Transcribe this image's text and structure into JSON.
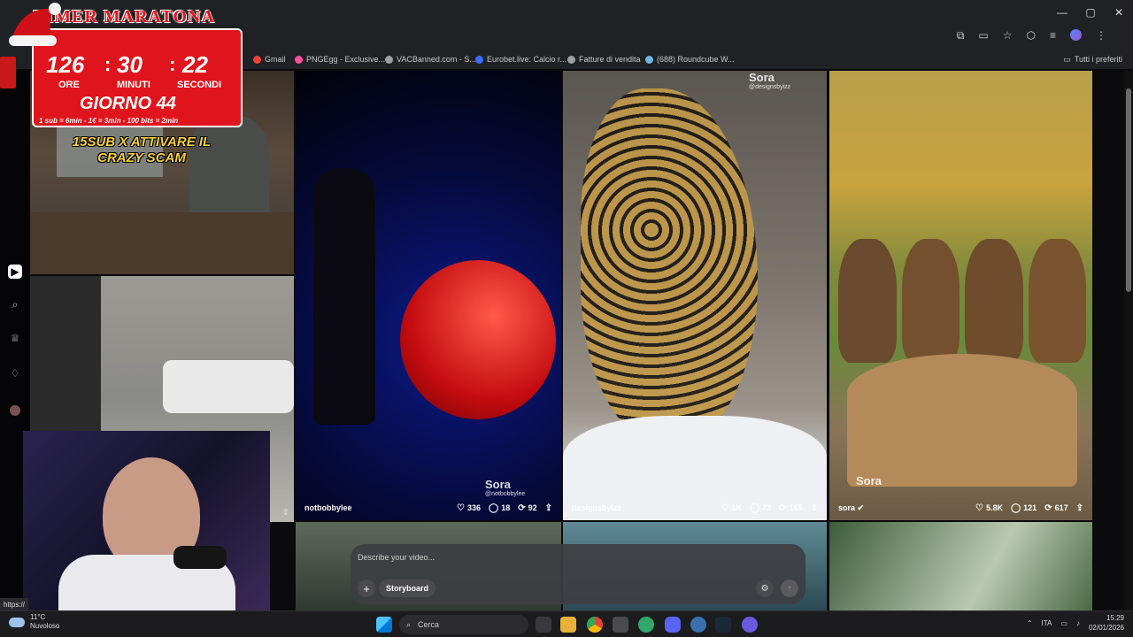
{
  "browser": {
    "window_controls": [
      "—",
      "▢",
      "✕"
    ],
    "bookmarks": [
      {
        "label": "Gmail",
        "icon": "gmail-icon",
        "color": "#ea4335"
      },
      {
        "label": "PNGEgg - Exclusive...",
        "icon": "pngegg-icon",
        "color": "#ff4fa0"
      },
      {
        "label": "VACBanned.com - S...",
        "icon": "vacbanned-icon",
        "color": "#9aa0a6"
      },
      {
        "label": "Eurobet.live: Calcio r...",
        "icon": "eurobet-icon",
        "color": "#3b6cff"
      },
      {
        "label": "Fatture di vendita",
        "icon": "fatture-icon",
        "color": "#9aa0a6"
      },
      {
        "label": "(688) Roundcube W...",
        "icon": "roundcube-icon",
        "color": "#6fb7e0"
      }
    ],
    "bookmarks_right": "Tutti i preferiti",
    "status_url": "https://"
  },
  "timer": {
    "title": "TIMER MARATONA",
    "hours": "126",
    "minutes": "30",
    "seconds": "22",
    "hours_label": "ORE",
    "minutes_label": "MINUTI",
    "seconds_label": "SECONDI",
    "day": "GIORNO 44",
    "rates": "1 sub = 6min - 1€ = 3min - 100 bits = 2min"
  },
  "promo": "15SUB X ATTIVARE IL CRAZY SCAM",
  "tiles": [
    {
      "user": "notbobbylee",
      "likes": "336",
      "comments": "18",
      "remixes": "92",
      "watermark": "Sora",
      "watermark_handle": "@notbobbylee"
    },
    {
      "user": "designsbyizz",
      "likes": "1K",
      "comments": "73",
      "remixes": "165",
      "watermark": "Sora",
      "watermark_handle": "@designsbyizz"
    },
    {
      "user": "sora",
      "likes": "5.8K",
      "comments": "121",
      "remixes": "617",
      "watermark": "Sora",
      "watermark_handle": ""
    }
  ],
  "prompt": {
    "placeholder": "Describe your video...",
    "storyboard_label": "Storyboard"
  },
  "taskbar": {
    "weather_temp": "11°C",
    "weather_desc": "Nuvoloso",
    "search_label": "Cerca",
    "language": "ITA",
    "time": "15:29",
    "date": "02/01/2026"
  }
}
